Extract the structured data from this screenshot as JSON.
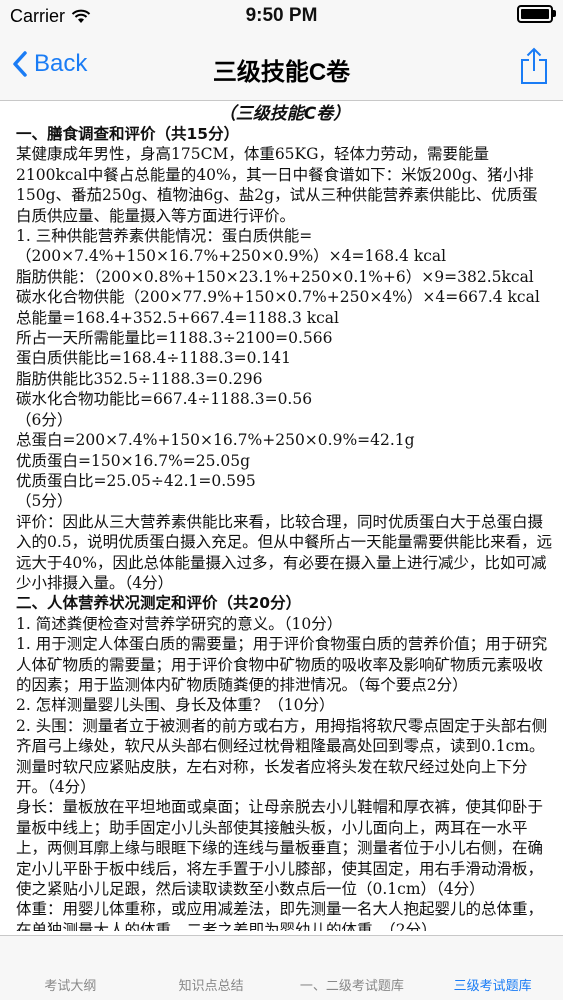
{
  "status_bar": {
    "carrier": "Carrier",
    "time": "9:50 PM"
  },
  "nav": {
    "back_label": "Back",
    "title": "三级技能C卷"
  },
  "doc": {
    "title": "（三级技能C卷）",
    "lines": [
      "一、膳食调查和评价（共15分）",
      "某健康成年男性，身高175CM，体重65KG，轻体力劳动，需要能量2100kcal中餐占总能量的40%，其一日中餐食谱如下：米饭200g、猪小排150g、番茄250g、植物油6g、盐2g，试从三种供能营养素供能比、优质蛋白质供应量、能量摄入等方面进行评价。",
      "1. 三种供能营养素供能情况：蛋白质供能=（200×7.4%+150×16.7%+250×0.9%）×4=168.4 kcal",
      "脂肪供能：（200×0.8%+150×23.1%+250×0.1%+6）×9=382.5kcal",
      "碳水化合物供能（200×77.9%+150×0.7%+250×4%）×4=667.4 kcal",
      "总能量=168.4+352.5+667.4=1188.3 kcal",
      "所占一天所需能量比=1188.3÷2100=0.566",
      "蛋白质供能比=168.4÷1188.3=0.141",
      "脂肪供能比352.5÷1188.3=0.296",
      "碳水化合物功能比=667.4÷1188.3=0.56",
      "（6分）",
      "总蛋白=200×7.4%+150×16.7%+250×0.9%=42.1g",
      "优质蛋白=150×16.7%=25.05g",
      "优质蛋白比=25.05÷42.1=0.595",
      "（5分）",
      "评价：因此从三大营养素供能比来看，比较合理，同时优质蛋白大于总蛋白摄入的0.5，说明优质蛋白摄入充足。但从中餐所占一天能量需要供能比来看，远远大于40%，因此总体能量摄入过多，有必要在摄入量上进行减少，比如可减少小排摄入量。（4分）",
      "二、人体营养状况测定和评价（共20分）",
      "1. 简述粪便检查对营养学研究的意义。（10分）",
      "1. 用于测定人体蛋白质的需要量；用于评价食物蛋白质的营养价值；用于研究人体矿物质的需要量；用于评价食物中矿物质的吸收率及影响矿物质元素吸收的因素；用于监测体内矿物质随粪便的排泄情况。（每个要点2分）",
      "2. 怎样测量婴儿头围、身长及体重？（10分）",
      "2. 头围：测量者立于被测者的前方或右方，用拇指将软尺零点固定于头部右侧齐眉弓上缘处，软尺从头部右侧经过枕骨粗隆最高处回到零点，读到0.1cm。测量时软尺应紧贴皮肤，左右对称，长发者应将头发在软尺经过处向上下分开。（4分）",
      "身长：量板放在平坦地面或桌面；让母亲脱去小儿鞋帽和厚衣裤，使其仰卧于量板中线上；助手固定小儿头部使其接触头板，小儿面向上，两耳在一水平上，两侧耳廓上缘与眼眶下缘的连线与量板垂直；测量者位于小儿右侧，在确定小儿平卧于板中线后，将左手置于小儿膝部，使其固定，用右手滑动滑板，使之紧贴小儿足跟，然后读取读数至小数点后一位（0.1cm）（4分）",
      "体重：用婴儿体重称，或应用减差法，即先测量一名大人抱起婴儿的总体重，在单独测量大人的体重，二者之差即为婴幼儿的体重。（2分）"
    ]
  },
  "tabs": [
    {
      "label": "考试大纲",
      "active": false
    },
    {
      "label": "知识点总结",
      "active": false
    },
    {
      "label": "一、二级考试题库",
      "active": false
    },
    {
      "label": "三级考试题库",
      "active": true
    }
  ],
  "colors": {
    "accent": "#1a7cf5",
    "bar_bg": "#f7f7f7",
    "inactive_tab": "#888888"
  }
}
